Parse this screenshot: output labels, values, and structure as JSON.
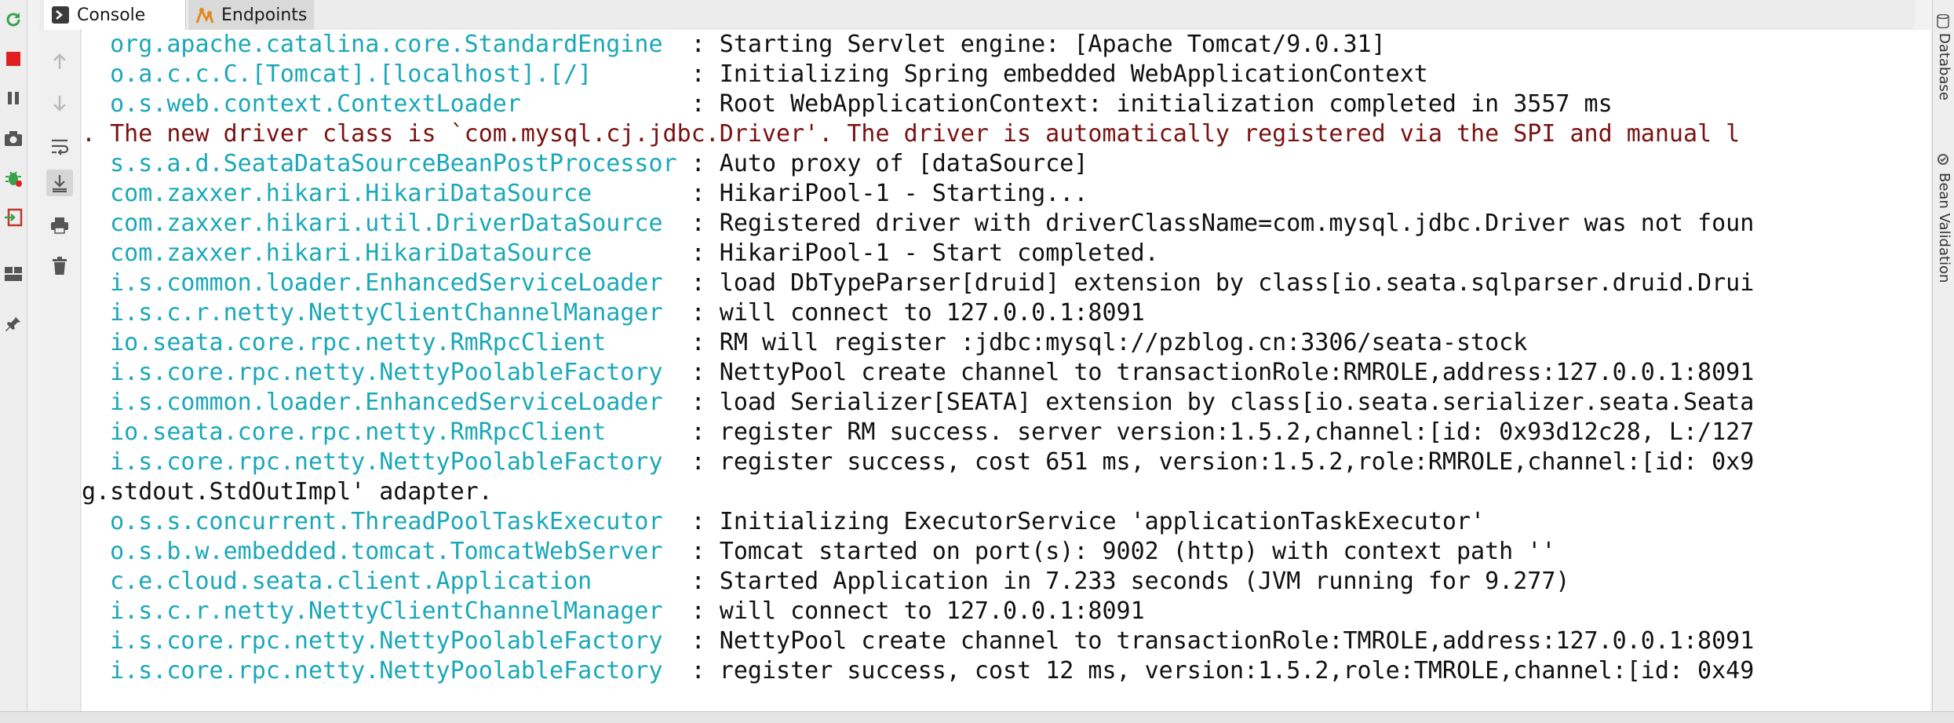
{
  "tabs": [
    {
      "label": "Console",
      "icon": "console-icon"
    },
    {
      "label": "Endpoints",
      "icon": "endpoints-icon"
    }
  ],
  "right_sidebar": {
    "database_label": "Database",
    "bean_validation_label": "Bean Validation"
  },
  "colors": {
    "logger": "#1aa8b8",
    "message": "#111111",
    "error": "#7a1212",
    "rerun": "#3aa14a",
    "stop": "#e02020"
  },
  "console": {
    "lines": [
      {
        "logger": "  org.apache.catalina.core.StandardEngine  ",
        "message": ": Starting Servlet engine: [Apache Tomcat/9.0.31]"
      },
      {
        "logger": "  o.a.c.c.C.[Tomcat].[localhost].[/]       ",
        "message": ": Initializing Spring embedded WebApplicationContext"
      },
      {
        "logger": "  o.s.web.context.ContextLoader            ",
        "message": ": Root WebApplicationContext: initialization completed in 3557 ms"
      },
      {
        "error": ". The new driver class is `com.mysql.cj.jdbc.Driver'. The driver is automatically registered via the SPI and manual l"
      },
      {
        "logger": "  s.s.a.d.SeataDataSourceBeanPostProcessor ",
        "message": ": Auto proxy of [dataSource]"
      },
      {
        "logger": "  com.zaxxer.hikari.HikariDataSource       ",
        "message": ": HikariPool-1 - Starting..."
      },
      {
        "logger": "  com.zaxxer.hikari.util.DriverDataSource  ",
        "message": ": Registered driver with driverClassName=com.mysql.jdbc.Driver was not foun"
      },
      {
        "logger": "  com.zaxxer.hikari.HikariDataSource       ",
        "message": ": HikariPool-1 - Start completed."
      },
      {
        "logger": "  i.s.common.loader.EnhancedServiceLoader  ",
        "message": ": load DbTypeParser[druid] extension by class[io.seata.sqlparser.druid.Drui"
      },
      {
        "logger": "  i.s.c.r.netty.NettyClientChannelManager  ",
        "message": ": will connect to 127.0.0.1:8091"
      },
      {
        "logger": "  io.seata.core.rpc.netty.RmRpcClient      ",
        "message": ": RM will register :jdbc:mysql://pzblog.cn:3306/seata-stock"
      },
      {
        "logger": "  i.s.core.rpc.netty.NettyPoolableFactory  ",
        "message": ": NettyPool create channel to transactionRole:RMROLE,address:127.0.0.1:8091"
      },
      {
        "logger": "  i.s.common.loader.EnhancedServiceLoader  ",
        "message": ": load Serializer[SEATA] extension by class[io.seata.serializer.seata.Seata"
      },
      {
        "logger": "  io.seata.core.rpc.netty.RmRpcClient      ",
        "message": ": register RM success. server version:1.5.2,channel:[id: 0x93d12c28, L:/127"
      },
      {
        "logger": "  i.s.core.rpc.netty.NettyPoolableFactory  ",
        "message": ": register success, cost 651 ms, version:1.5.2,role:RMROLE,channel:[id: 0x9"
      },
      {
        "plain": "g.stdout.StdOutImpl' adapter."
      },
      {
        "logger": "  o.s.s.concurrent.ThreadPoolTaskExecutor  ",
        "message": ": Initializing ExecutorService 'applicationTaskExecutor'"
      },
      {
        "logger": "  o.s.b.w.embedded.tomcat.TomcatWebServer  ",
        "message": ": Tomcat started on port(s): 9002 (http) with context path ''"
      },
      {
        "logger": "  c.e.cloud.seata.client.Application       ",
        "message": ": Started Application in 7.233 seconds (JVM running for 9.277)"
      },
      {
        "logger": "  i.s.c.r.netty.NettyClientChannelManager  ",
        "message": ": will connect to 127.0.0.1:8091"
      },
      {
        "logger": "  i.s.core.rpc.netty.NettyPoolableFactory  ",
        "message": ": NettyPool create channel to transactionRole:TMROLE,address:127.0.0.1:8091"
      },
      {
        "logger": "  i.s.core.rpc.netty.NettyPoolableFactory  ",
        "message": ": register success, cost 12 ms, version:1.5.2,role:TMROLE,channel:[id: 0x49"
      }
    ]
  }
}
